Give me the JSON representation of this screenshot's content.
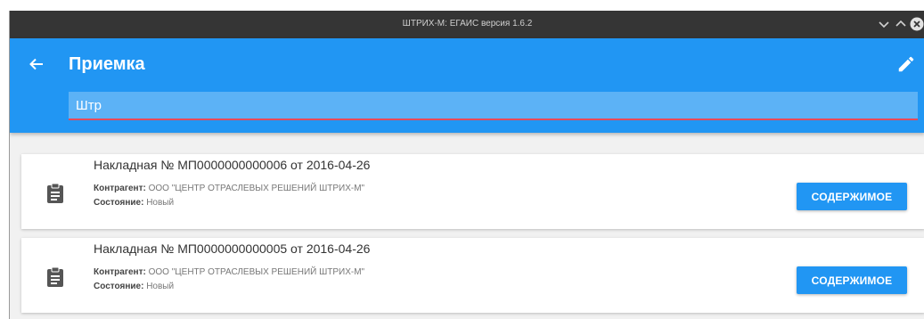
{
  "window": {
    "title": "ШТРИХ-М: ЕГАИС версия 1.6.2"
  },
  "appbar": {
    "title": "Приемка",
    "colors": {
      "primary": "#2196f3",
      "search_bg": "#5cb2f6",
      "underline": "#e64a5a"
    }
  },
  "search": {
    "value": "Штр"
  },
  "invoices": [
    {
      "heading": "Накладная № МП0000000000006 от 2016-04-26",
      "counterparty_label": "Контрагент:",
      "counterparty": "ООО \"ЦЕНТР ОТРАСЛЕВЫХ РЕШЕНИЙ ШТРИХ-М\"",
      "status_label": "Состояние:",
      "status": "Новый",
      "button_label": "СОДЕРЖИМОЕ",
      "icon": "clipboard-icon"
    },
    {
      "heading": "Накладная № МП0000000000005 от 2016-04-26",
      "counterparty_label": "Контрагент:",
      "counterparty": "ООО \"ЦЕНТР ОТРАСЛЕВЫХ РЕШЕНИЙ ШТРИХ-М\"",
      "status_label": "Состояние:",
      "status": "Новый",
      "button_label": "СОДЕРЖИМОЕ",
      "icon": "clipboard-icon"
    }
  ]
}
